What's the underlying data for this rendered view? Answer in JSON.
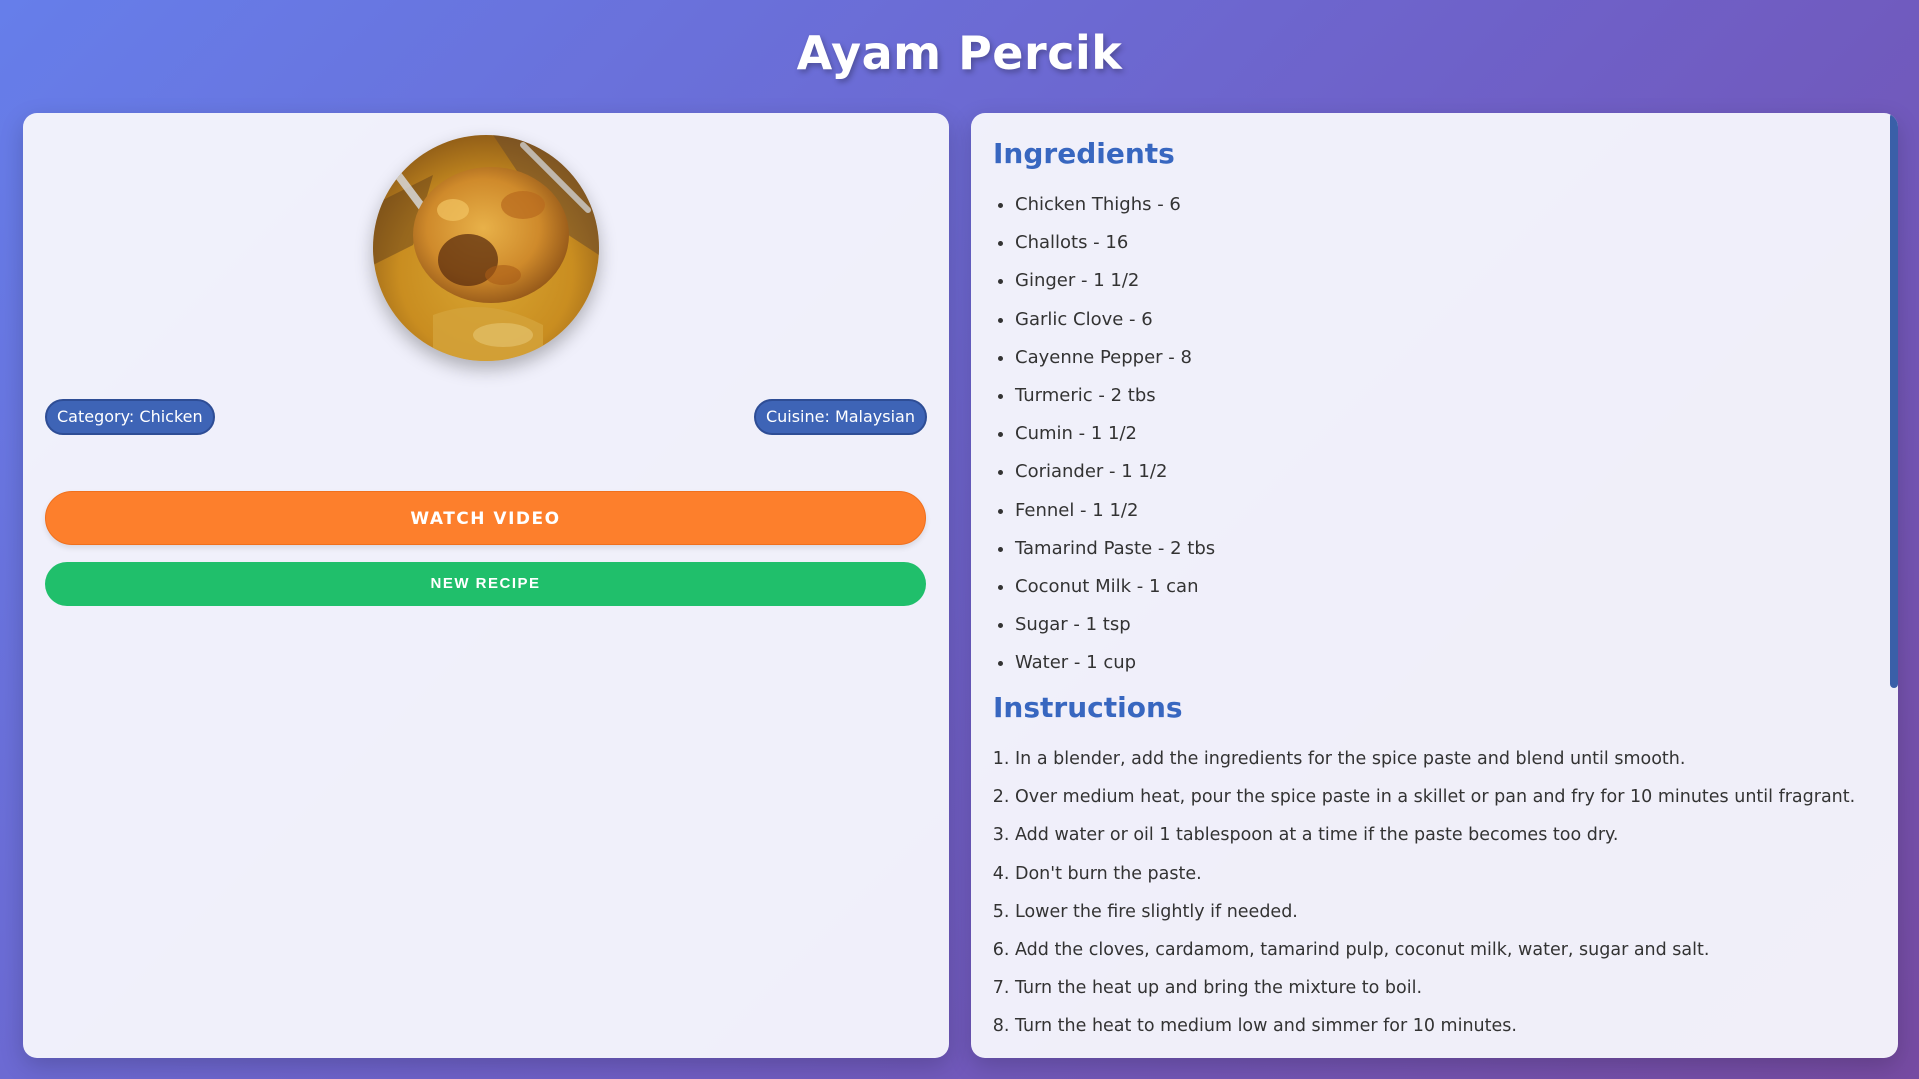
{
  "page": {
    "title": "Ayam Percik"
  },
  "meal": {
    "image_alt": "Ayam Percik",
    "category_label": "Category: Chicken",
    "cuisine_label": "Cuisine: Malaysian"
  },
  "actions": {
    "watch_video_label": "WATCH VIDEO",
    "new_recipe_label": "NEW RECIPE"
  },
  "ingredients": {
    "heading": "Ingredients",
    "items": [
      "Chicken Thighs - 6",
      "Challots - 16",
      "Ginger - 1 1/2",
      "Garlic Clove - 6",
      "Cayenne Pepper - 8",
      "Turmeric - 2 tbs",
      "Cumin - 1 1/2",
      "Coriander - 1 1/2",
      "Fennel - 1 1/2",
      "Tamarind Paste - 2 tbs",
      "Coconut Milk - 1 can",
      "Sugar - 1 tsp",
      "Water - 1 cup"
    ]
  },
  "instructions": {
    "heading": "Instructions",
    "steps": [
      "In a blender, add the ingredients for the spice paste and blend until smooth.",
      "Over medium heat, pour the spice paste in a skillet or pan and fry for 10 minutes until fragrant.",
      "Add water or oil 1 tablespoon at a time if the paste becomes too dry.",
      "Don't burn the paste.",
      "Lower the fire slightly if needed.",
      "Add the cloves, cardamom, tamarind pulp, coconut milk, water, sugar and salt.",
      "Turn the heat up and bring the mixture to boil.",
      "Turn the heat to medium low and simmer for 10 minutes."
    ]
  },
  "colors": {
    "background_start": "#667eea",
    "background_end": "#764ba2",
    "heading_blue": "#3867c0",
    "tag_blue": "#3e64b6",
    "watch_video_orange": "#fd7f2c",
    "new_recipe_green": "#20bf6b"
  }
}
